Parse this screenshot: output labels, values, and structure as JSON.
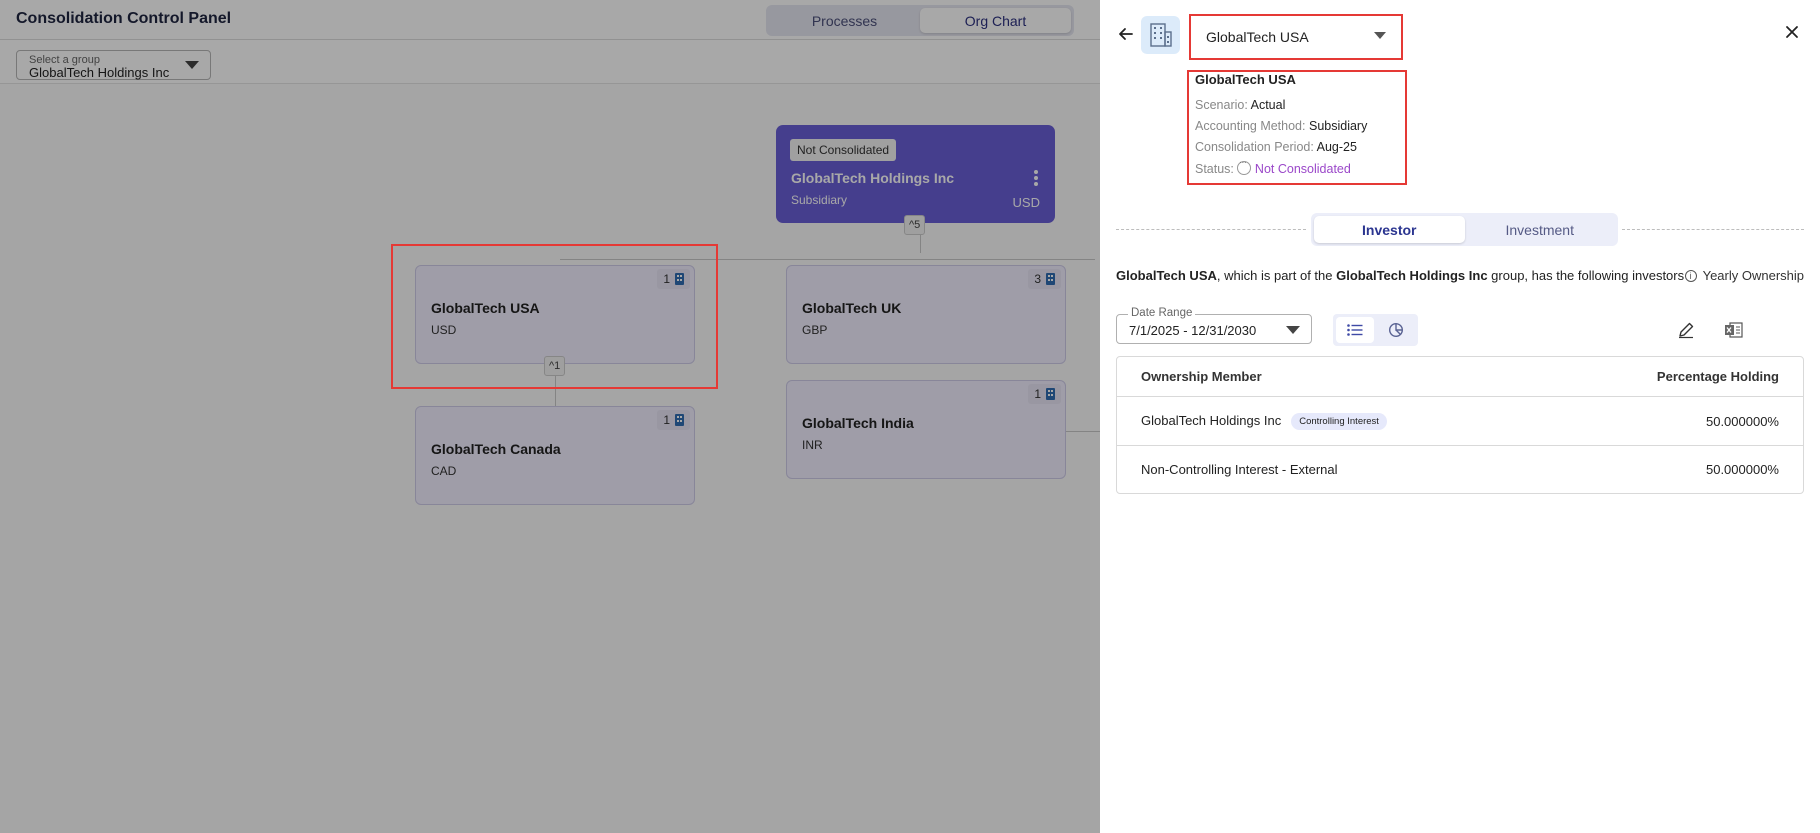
{
  "app": {
    "title": "Consolidation Control Panel",
    "view_tabs": [
      {
        "label": "Processes",
        "active": false
      },
      {
        "label": "Org Chart",
        "active": true
      }
    ],
    "group_select": {
      "label": "Select a group",
      "value": "GlobalTech Holdings Inc"
    }
  },
  "org_chart": {
    "root": {
      "badge": "Not Consolidated",
      "name": "GlobalTech Holdings Inc",
      "method": "Subsidiary",
      "currency": "USD",
      "children_toggle": "^5"
    },
    "nodes": [
      {
        "name": "GlobalTech USA",
        "currency": "USD",
        "count": "1",
        "children_toggle": "^1"
      },
      {
        "name": "GlobalTech UK",
        "currency": "GBP",
        "count": "3"
      },
      {
        "name": "GlobalTech Canada",
        "currency": "CAD",
        "count": "1"
      },
      {
        "name": "GlobalTech India",
        "currency": "INR",
        "count": "1"
      }
    ]
  },
  "drawer": {
    "entity_select": "GlobalTech USA",
    "info": {
      "name": "GlobalTech USA",
      "scenario_label": "Scenario:",
      "scenario": "Actual",
      "method_label": "Accounting Method:",
      "method": "Subsidiary",
      "period_label": "Consolidation Period:",
      "period": "Aug-25",
      "status_label": "Status:",
      "status": "Not Consolidated"
    },
    "tabs": [
      {
        "label": "Investor",
        "active": true
      },
      {
        "label": "Investment",
        "active": false
      }
    ],
    "sentence": {
      "entity": "GlobalTech USA",
      "mid": ", which is part of the ",
      "group": "GlobalTech Holdings Inc",
      "end": " group, has the following investors"
    },
    "yearly_ownership": "Yearly Ownership",
    "date_range": {
      "label": "Date Range",
      "value": "7/1/2025 - 12/31/2030"
    },
    "table": {
      "headers": [
        "Ownership Member",
        "Percentage Holding"
      ],
      "rows": [
        {
          "member": "GlobalTech Holdings Inc",
          "tag": "Controlling Interest",
          "pct": "50.000000%"
        },
        {
          "member": "Non-Controlling Interest - External",
          "tag": "",
          "pct": "50.000000%"
        }
      ]
    }
  },
  "colors": {
    "root_node": "#6a5fd6",
    "node_bg": "#f1efff",
    "highlight": "#e53935",
    "status_text": "#9b48c9"
  }
}
